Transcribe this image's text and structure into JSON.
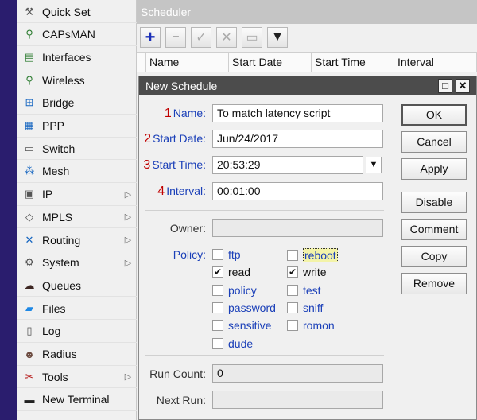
{
  "sidebar": {
    "items": [
      {
        "label": "Quick Set",
        "icon": "quick-set-icon",
        "glyph": "⚒",
        "color": "#555555",
        "arrow": false
      },
      {
        "label": "CAPsMAN",
        "icon": "capsman-icon",
        "glyph": "⚲",
        "color": "#2e7d32",
        "arrow": false
      },
      {
        "label": "Interfaces",
        "icon": "interfaces-icon",
        "glyph": "▤",
        "color": "#2e7d32",
        "arrow": false
      },
      {
        "label": "Wireless",
        "icon": "wireless-icon",
        "glyph": "⚲",
        "color": "#2e7d32",
        "arrow": false
      },
      {
        "label": "Bridge",
        "icon": "bridge-icon",
        "glyph": "⊞",
        "color": "#1565c0",
        "arrow": false
      },
      {
        "label": "PPP",
        "icon": "ppp-icon",
        "glyph": "▦",
        "color": "#1565c0",
        "arrow": false
      },
      {
        "label": "Switch",
        "icon": "switch-icon",
        "glyph": "▭",
        "color": "#555555",
        "arrow": false
      },
      {
        "label": "Mesh",
        "icon": "mesh-icon",
        "glyph": "⁂",
        "color": "#1565c0",
        "arrow": false
      },
      {
        "label": "IP",
        "icon": "ip-icon",
        "glyph": "▣",
        "color": "#555555",
        "arrow": true
      },
      {
        "label": "MPLS",
        "icon": "mpls-icon",
        "glyph": "◇",
        "color": "#555555",
        "arrow": true
      },
      {
        "label": "Routing",
        "icon": "routing-icon",
        "glyph": "✕",
        "color": "#1565c0",
        "arrow": true
      },
      {
        "label": "System",
        "icon": "system-gear-icon",
        "glyph": "⚙",
        "color": "#555555",
        "arrow": true
      },
      {
        "label": "Queues",
        "icon": "queues-icon",
        "glyph": "☁",
        "color": "#3e2723",
        "arrow": false
      },
      {
        "label": "Files",
        "icon": "files-folder-icon",
        "glyph": "▰",
        "color": "#1e88e5",
        "arrow": false
      },
      {
        "label": "Log",
        "icon": "log-icon",
        "glyph": "▯",
        "color": "#555555",
        "arrow": false
      },
      {
        "label": "Radius",
        "icon": "radius-users-icon",
        "glyph": "☻",
        "color": "#6d4c41",
        "arrow": false
      },
      {
        "label": "Tools",
        "icon": "tools-icon",
        "glyph": "✂",
        "color": "#b71c1c",
        "arrow": true
      },
      {
        "label": "New Terminal",
        "icon": "terminal-icon",
        "glyph": "▬",
        "color": "#222222",
        "arrow": false
      }
    ]
  },
  "scheduler": {
    "title": "Scheduler",
    "columns": [
      "Name",
      "Start Date",
      "Start Time",
      "Interval"
    ]
  },
  "dialog": {
    "title": "New Schedule",
    "fields": {
      "name": {
        "num": "1",
        "label": "Name:",
        "value": "To match latency script"
      },
      "start_date": {
        "num": "2",
        "label": "Start Date:",
        "value": "Jun/24/2017"
      },
      "start_time": {
        "num": "3",
        "label": "Start Time:",
        "value": "20:53:29"
      },
      "interval": {
        "num": "4",
        "label": "Interval:",
        "value": "00:01:00"
      },
      "owner": {
        "label": "Owner:",
        "value": ""
      },
      "run_count": {
        "label": "Run Count:",
        "value": "0"
      },
      "next_run": {
        "label": "Next Run:",
        "value": ""
      }
    },
    "policy_label": "Policy:",
    "policies_left": [
      {
        "label": "ftp",
        "checked": false
      },
      {
        "label": "read",
        "checked": true
      },
      {
        "label": "policy",
        "checked": false
      },
      {
        "label": "password",
        "checked": false
      },
      {
        "label": "sensitive",
        "checked": false
      },
      {
        "label": "dude",
        "checked": false
      }
    ],
    "policies_right": [
      {
        "label": "reboot",
        "checked": false
      },
      {
        "label": "write",
        "checked": true
      },
      {
        "label": "test",
        "checked": false
      },
      {
        "label": "sniff",
        "checked": false
      },
      {
        "label": "romon",
        "checked": false
      }
    ],
    "buttons": [
      "OK",
      "Cancel",
      "Apply",
      "Disable",
      "Comment",
      "Copy",
      "Remove"
    ]
  }
}
